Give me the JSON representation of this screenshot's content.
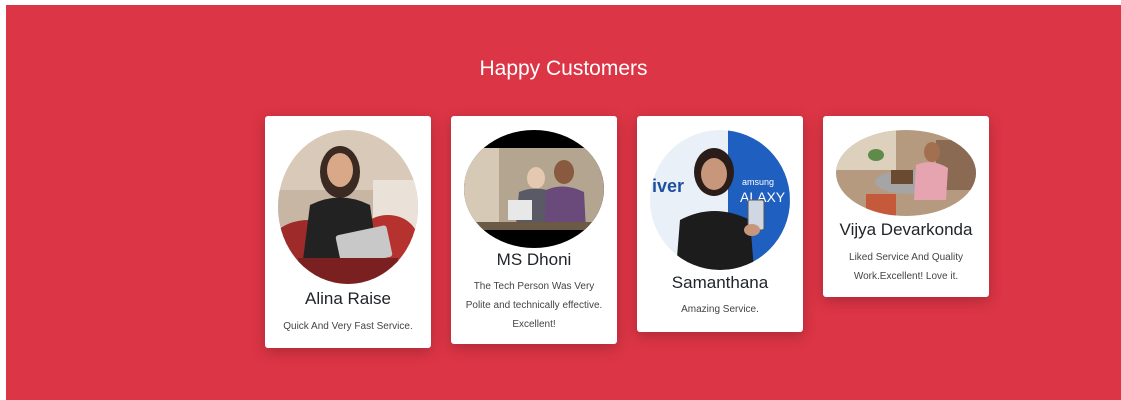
{
  "section": {
    "title": "Happy Customers",
    "background": "#dc3545"
  },
  "customers": [
    {
      "name": "Alina Raise",
      "review": "Quick And Very Fast Service.",
      "photo": "customer-photo"
    },
    {
      "name": "MS Dhoni",
      "review": "The Tech Person Was Very Polite and technically effective. Excellent!",
      "photo": "customer-photo"
    },
    {
      "name": "Samanthana",
      "review": "Amazing Service.",
      "photo": "customer-photo"
    },
    {
      "name": "Vijya Devarkonda",
      "review": "Liked Service And Quality Work.Excellent! Love it.",
      "photo": "customer-photo"
    }
  ]
}
